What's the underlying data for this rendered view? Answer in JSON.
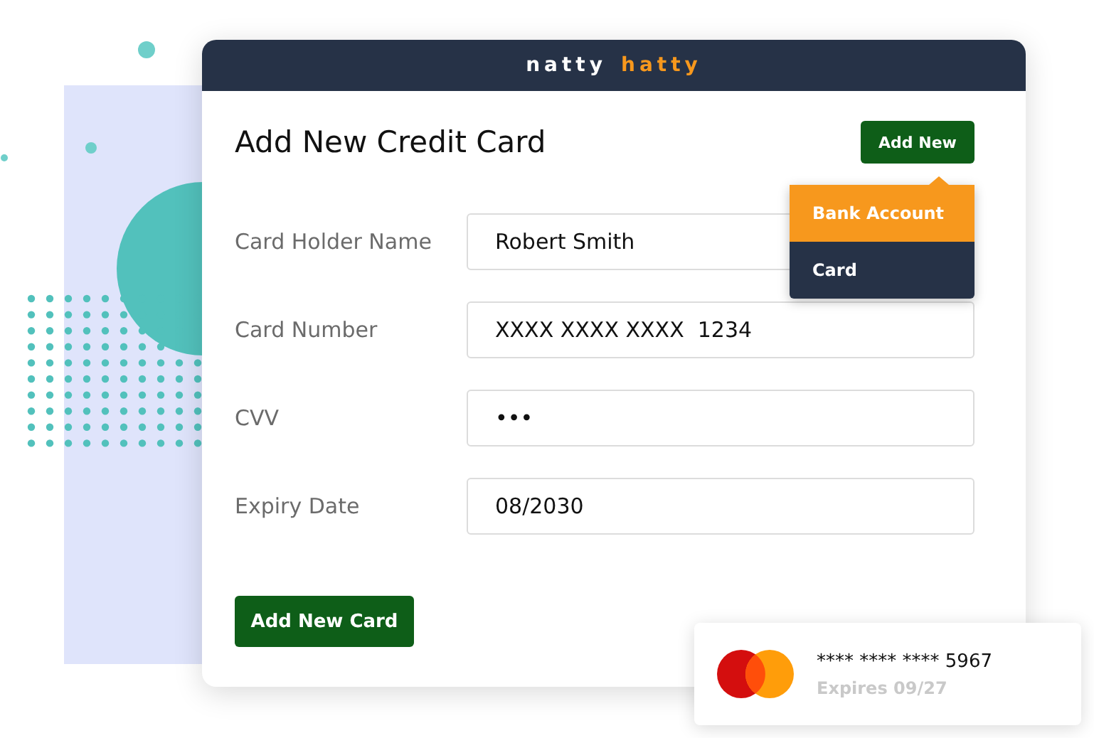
{
  "brand": {
    "first": "natty",
    "second": "hatty"
  },
  "title": "Add New Credit Card",
  "add_button": "Add New",
  "menu": [
    {
      "label": "Bank Account",
      "selected": true
    },
    {
      "label": "Card",
      "selected": false
    }
  ],
  "fields": [
    {
      "label": "Card Holder Name",
      "value": "Robert Smith"
    },
    {
      "label": "Card Number",
      "value": "XXXX XXXX XXXX  1234"
    },
    {
      "label": "CVV",
      "value": "•••"
    },
    {
      "label": "Expiry Date",
      "value": "08/2030"
    }
  ],
  "submit": "Add New Card",
  "saved_card": {
    "number": "**** **** **** 5967",
    "expiry": "Expires 09/27"
  }
}
